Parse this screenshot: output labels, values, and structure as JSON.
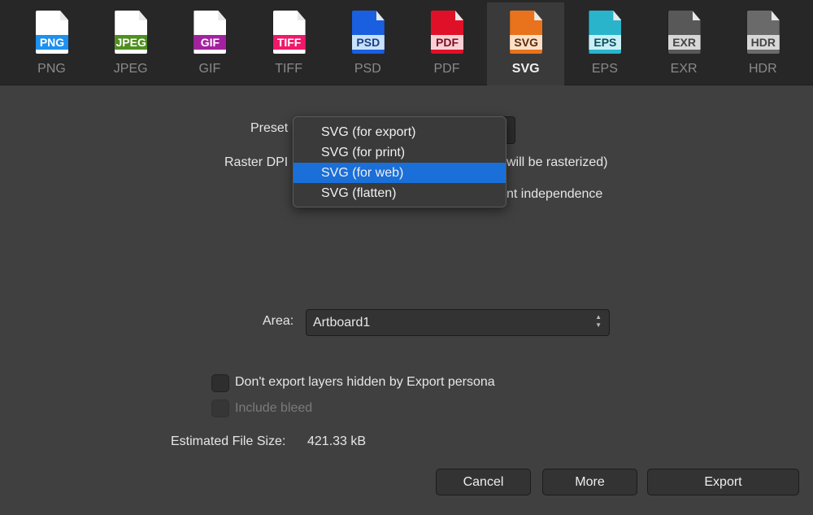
{
  "formats": [
    {
      "label": "PNG",
      "color": "#ffffff",
      "band": "#1e90f0",
      "band_text": "#ffffff"
    },
    {
      "label": "JPEG",
      "color": "#ffffff",
      "band": "#4f8f1f",
      "band_text": "#ffffff"
    },
    {
      "label": "GIF",
      "color": "#ffffff",
      "band": "#a321a0",
      "band_text": "#ffffff"
    },
    {
      "label": "TIFF",
      "color": "#ffffff",
      "band": "#f0186a",
      "band_text": "#ffffff"
    },
    {
      "label": "PSD",
      "color": "#1a5fe0",
      "band": "#c8e2fb",
      "band_text": "#1b3f86"
    },
    {
      "label": "PDF",
      "color": "#e01028",
      "band": "#fbd0d5",
      "band_text": "#7a1020"
    },
    {
      "label": "SVG",
      "color": "#e8731c",
      "band": "#fde0c8",
      "band_text": "#5a2c0c"
    },
    {
      "label": "EPS",
      "color": "#2ab4cc",
      "band": "#c8f0f6",
      "band_text": "#0c4f5c"
    },
    {
      "label": "EXR",
      "color": "#585858",
      "band": "#d8d8d8",
      "band_text": "#444444"
    },
    {
      "label": "HDR",
      "color": "#6a6a6a",
      "band": "#d8d8d8",
      "band_text": "#444444"
    }
  ],
  "active_format": "SVG",
  "preset_label": "Preset",
  "raster_dpi_label": "Raster DPI",
  "raster_note_visible": "will be rasterized)",
  "independence_visible": "nt independence",
  "preset_menu": {
    "items": [
      "SVG (for export)",
      "SVG (for print)",
      "SVG (for web)",
      "SVG (flatten)"
    ],
    "highlighted": "SVG (for web)"
  },
  "area": {
    "label": "Area:",
    "value": "Artboard1"
  },
  "checkboxes": [
    {
      "label": "Don't export layers hidden by Export persona",
      "checked": false,
      "enabled": true
    },
    {
      "label": "Include bleed",
      "checked": false,
      "enabled": false
    }
  ],
  "file_size": {
    "label": "Estimated File Size:",
    "value": "421.33 kB"
  },
  "buttons": {
    "cancel": "Cancel",
    "more": "More",
    "export": "Export"
  },
  "accent": "#1a6fd8"
}
